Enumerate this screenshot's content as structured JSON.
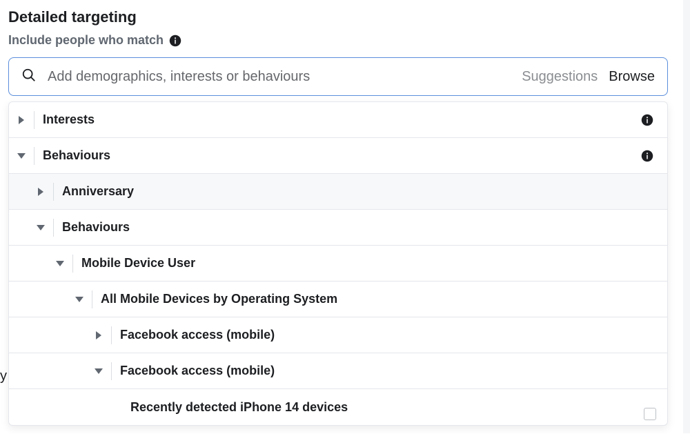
{
  "header": {
    "title": "Detailed targeting",
    "subtitle": "Include people who match"
  },
  "search": {
    "placeholder": "Add demographics, interests or behaviours",
    "suggestions_label": "Suggestions",
    "browse_label": "Browse"
  },
  "tree": {
    "interests": {
      "label": "Interests"
    },
    "behaviours": {
      "label": "Behaviours"
    },
    "anniversary": {
      "label": "Anniversary"
    },
    "behaviours2": {
      "label": "Behaviours"
    },
    "mobile_device_user": {
      "label": "Mobile Device User"
    },
    "all_mobile_os": {
      "label": "All Mobile Devices by Operating System"
    },
    "fb_access_mobile_1": {
      "label": "Facebook access (mobile)"
    },
    "fb_access_mobile_2": {
      "label": "Facebook access (mobile)"
    },
    "iphone14": {
      "label": "Recently detected iPhone 14 devices"
    }
  },
  "stray": {
    "y": "y"
  }
}
